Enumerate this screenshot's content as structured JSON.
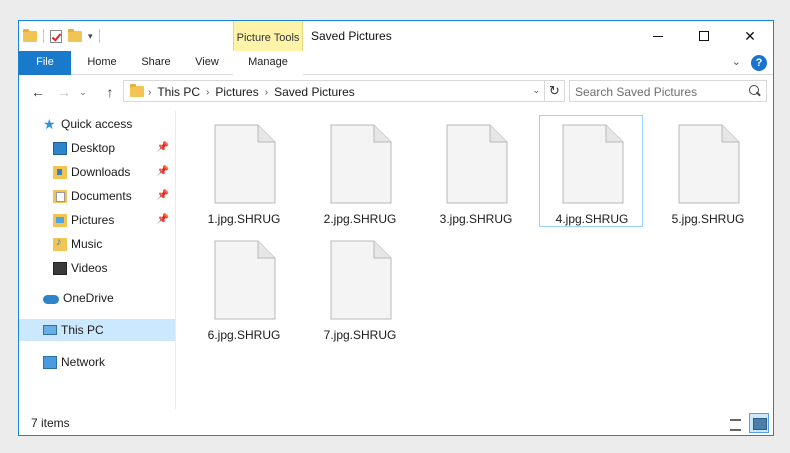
{
  "window": {
    "title": "Saved Pictures",
    "accent": "#1883d7"
  },
  "ribbon": {
    "contextual_header": "Picture Tools",
    "tabs": [
      {
        "label": "File"
      },
      {
        "label": "Home"
      },
      {
        "label": "Share"
      },
      {
        "label": "View"
      },
      {
        "label": "Manage"
      }
    ]
  },
  "address": {
    "crumbs": [
      "This PC",
      "Pictures",
      "Saved Pictures"
    ]
  },
  "search": {
    "placeholder": "Search Saved Pictures"
  },
  "navpane": {
    "quick_access": "Quick access",
    "quick_items": [
      {
        "label": "Desktop",
        "pinned": true,
        "icon": "desktop-icon"
      },
      {
        "label": "Downloads",
        "pinned": true,
        "icon": "downloads-icon"
      },
      {
        "label": "Documents",
        "pinned": true,
        "icon": "documents-icon"
      },
      {
        "label": "Pictures",
        "pinned": true,
        "icon": "pictures-icon"
      },
      {
        "label": "Music",
        "pinned": false,
        "icon": "music-icon"
      },
      {
        "label": "Videos",
        "pinned": false,
        "icon": "videos-icon"
      }
    ],
    "onedrive": "OneDrive",
    "this_pc": "This PC",
    "network": "Network"
  },
  "files": [
    {
      "name": "1.jpg.SHRUG",
      "selected": false
    },
    {
      "name": "2.jpg.SHRUG",
      "selected": false
    },
    {
      "name": "3.jpg.SHRUG",
      "selected": false
    },
    {
      "name": "4.jpg.SHRUG",
      "selected": true
    },
    {
      "name": "5.jpg.SHRUG",
      "selected": false
    },
    {
      "name": "6.jpg.SHRUG",
      "selected": false
    },
    {
      "name": "7.jpg.SHRUG",
      "selected": false
    }
  ],
  "status": {
    "item_count": "7 items"
  }
}
